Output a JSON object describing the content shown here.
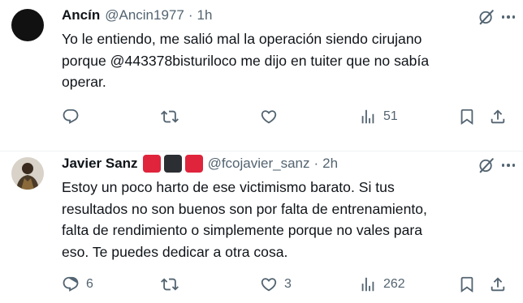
{
  "tweets": [
    {
      "display_name": "Ancín",
      "handle": "@Ancin1977",
      "separator": "·",
      "time": "1h",
      "text": "Yo le entiendo, me salió mal la operación siendo cirujano\nporque @443378bisturiloco me dijo en tuiter que no sabía\noperar.",
      "avatar_color": "#111111",
      "flags": [],
      "counts": {
        "replies": "",
        "retweets": "",
        "likes": "",
        "views": "51"
      }
    },
    {
      "display_name": "Javier Sanz",
      "handle": "@fcojavier_sanz",
      "separator": "·",
      "time": "2h",
      "text": "Estoy un poco harto de ese victimismo barato. Si tus\nresultados no son buenos son por falta de entrenamiento,\nfalta de rendimiento o simplemente porque no vales para\neso. Te puedes dedicar a otra cosa.",
      "avatar_color": "#5a4632",
      "flags": [
        "#e0243c",
        "#2b2f33",
        "#e0243c"
      ],
      "counts": {
        "replies": "6",
        "retweets": "",
        "likes": "3",
        "views": "262"
      }
    }
  ],
  "icons": {
    "reply": "reply-icon",
    "retweet": "retweet-icon",
    "like": "heart-icon",
    "views": "views-chart-icon",
    "bookmark": "bookmark-icon",
    "share": "share-icon",
    "grok": "grok-icon",
    "more": "more-dots-icon"
  },
  "colors": {
    "text": "#0f1419",
    "secondary": "#536471",
    "divider": "#eff3f4"
  }
}
